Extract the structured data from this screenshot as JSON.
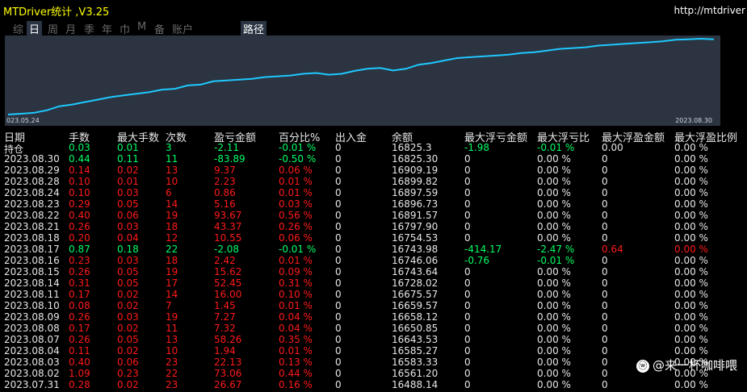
{
  "window": {
    "title": "MTDriver统计 ,V3.25",
    "url": "http://mtdriver"
  },
  "tabs": [
    {
      "label": "综"
    },
    {
      "label": "日"
    },
    {
      "label": "周"
    },
    {
      "label": "月"
    },
    {
      "label": "季"
    },
    {
      "label": "年"
    },
    {
      "label": "巾"
    },
    {
      "label": "M"
    },
    {
      "label": "备"
    },
    {
      "label": "账户"
    },
    {
      "label": "路径"
    }
  ],
  "chart": {
    "start_date": "023.05.24",
    "end_date": "2023.08.30",
    "line_color": "#1ec8ff",
    "background": "#2b3440"
  },
  "chart_data": {
    "type": "line",
    "x": [
      "023.05.24",
      "2023.08.30"
    ],
    "series": [
      {
        "values": [
          15000,
          15020,
          15040,
          15100,
          15200,
          15240,
          15300,
          15360,
          15420,
          15460,
          15500,
          15540,
          15600,
          15620,
          15700,
          15720,
          15800,
          15820,
          15840,
          15860,
          15900,
          15920,
          15940,
          15980,
          16000,
          15960,
          15980,
          16050,
          16100,
          16120,
          16060,
          16100,
          16200,
          16240,
          16300,
          16360,
          16380,
          16400,
          16420,
          16440,
          16480,
          16500,
          16540,
          16580,
          16600,
          16620,
          16660,
          16680,
          16700,
          16720,
          16740,
          16760,
          16800,
          16810,
          16825,
          16810
        ]
      }
    ]
  },
  "colors": {
    "positive": "#00ff66",
    "negative": "#ff1a1a",
    "neutral": "#e6e6e6",
    "title": "#ffff00"
  },
  "table": {
    "headers": [
      "日期",
      "手数",
      "最大手数",
      "次数",
      "盈亏金额",
      "百分比%",
      "出入金",
      "余额",
      "最大浮亏金额",
      "最大浮亏比",
      "最大浮盈金额",
      "最大浮盈比例"
    ],
    "rows": [
      {
        "date": "持仓",
        "lots": "0.03",
        "maxlots": "0.01",
        "count": "3",
        "pnl": "-2.11",
        "pct": "-0.01 %",
        "io": "0",
        "bal": "16825.3",
        "mfl": "-1.98",
        "mflp": "-0.01 %",
        "mfp": "0.00",
        "mfpp": "0.00 %",
        "color": "pos"
      },
      {
        "date": "2023.08.30",
        "lots": "0.44",
        "maxlots": "0.11",
        "count": "11",
        "pnl": "-83.89",
        "pct": "-0.50 %",
        "io": "0",
        "bal": "16825.30",
        "mfl": "0",
        "mflp": "0.00 %",
        "mfp": "0",
        "mfpp": "0.00 %",
        "color": "pos"
      },
      {
        "date": "2023.08.29",
        "lots": "0.14",
        "maxlots": "0.02",
        "count": "13",
        "pnl": "9.37",
        "pct": "0.06 %",
        "io": "0",
        "bal": "16909.19",
        "mfl": "0",
        "mflp": "0.00 %",
        "mfp": "0",
        "mfpp": "0.00 %",
        "color": "neg"
      },
      {
        "date": "2023.08.28",
        "lots": "0.10",
        "maxlots": "0.01",
        "count": "10",
        "pnl": "2.23",
        "pct": "0.01 %",
        "io": "0",
        "bal": "16899.82",
        "mfl": "0",
        "mflp": "0.00 %",
        "mfp": "0",
        "mfpp": "0.00 %",
        "color": "neg"
      },
      {
        "date": "2023.08.24",
        "lots": "0.10",
        "maxlots": "0.03",
        "count": "6",
        "pnl": "0.86",
        "pct": "0.01 %",
        "io": "0",
        "bal": "16897.59",
        "mfl": "0",
        "mflp": "0.00 %",
        "mfp": "0",
        "mfpp": "0.00 %",
        "color": "neg"
      },
      {
        "date": "2023.08.23",
        "lots": "0.29",
        "maxlots": "0.05",
        "count": "14",
        "pnl": "5.16",
        "pct": "0.03 %",
        "io": "0",
        "bal": "16896.73",
        "mfl": "0",
        "mflp": "0.00 %",
        "mfp": "0",
        "mfpp": "0.00 %",
        "color": "neg"
      },
      {
        "date": "2023.08.22",
        "lots": "0.40",
        "maxlots": "0.06",
        "count": "19",
        "pnl": "93.67",
        "pct": "0.56 %",
        "io": "0",
        "bal": "16891.57",
        "mfl": "0",
        "mflp": "0.00 %",
        "mfp": "0",
        "mfpp": "0.00 %",
        "color": "neg"
      },
      {
        "date": "2023.08.21",
        "lots": "0.26",
        "maxlots": "0.03",
        "count": "18",
        "pnl": "43.37",
        "pct": "0.26 %",
        "io": "0",
        "bal": "16797.90",
        "mfl": "0",
        "mflp": "0.00 %",
        "mfp": "0",
        "mfpp": "0.00 %",
        "color": "neg"
      },
      {
        "date": "2023.08.18",
        "lots": "0.20",
        "maxlots": "0.04",
        "count": "12",
        "pnl": "10.55",
        "pct": "0.06 %",
        "io": "0",
        "bal": "16754.53",
        "mfl": "0",
        "mflp": "0.00 %",
        "mfp": "0",
        "mfpp": "0.00 %",
        "color": "neg"
      },
      {
        "date": "2023.08.17",
        "lots": "0.87",
        "maxlots": "0.18",
        "count": "22",
        "pnl": "-2.08",
        "pct": "-0.01 %",
        "io": "0",
        "bal": "16743.98",
        "mfl": "-414.17",
        "mflp": "-2.47 %",
        "mfp": "0.64",
        "mfpp": "0.00 %",
        "color": "pos",
        "mfp_red": true
      },
      {
        "date": "2023.08.16",
        "lots": "0.23",
        "maxlots": "0.03",
        "count": "18",
        "pnl": "2.42",
        "pct": "0.01 %",
        "io": "0",
        "bal": "16746.06",
        "mfl": "-0.76",
        "mflp": "-0.01 %",
        "mfp": "0",
        "mfpp": "0.00 %",
        "color": "neg",
        "mfl_green": true
      },
      {
        "date": "2023.08.15",
        "lots": "0.26",
        "maxlots": "0.05",
        "count": "19",
        "pnl": "15.62",
        "pct": "0.09 %",
        "io": "0",
        "bal": "16743.64",
        "mfl": "0",
        "mflp": "0.00 %",
        "mfp": "0",
        "mfpp": "0.00 %",
        "color": "neg"
      },
      {
        "date": "2023.08.14",
        "lots": "0.31",
        "maxlots": "0.05",
        "count": "17",
        "pnl": "52.45",
        "pct": "0.31 %",
        "io": "0",
        "bal": "16728.02",
        "mfl": "0",
        "mflp": "0.00 %",
        "mfp": "0",
        "mfpp": "0.00 %",
        "color": "neg"
      },
      {
        "date": "2023.08.11",
        "lots": "0.17",
        "maxlots": "0.02",
        "count": "14",
        "pnl": "16.00",
        "pct": "0.10 %",
        "io": "0",
        "bal": "16675.57",
        "mfl": "0",
        "mflp": "0.00 %",
        "mfp": "0",
        "mfpp": "0.00 %",
        "color": "neg"
      },
      {
        "date": "2023.08.10",
        "lots": "0.08",
        "maxlots": "0.02",
        "count": "7",
        "pnl": "1.45",
        "pct": "0.01 %",
        "io": "0",
        "bal": "16659.57",
        "mfl": "0",
        "mflp": "0.00 %",
        "mfp": "0",
        "mfpp": "0.00 %",
        "color": "neg"
      },
      {
        "date": "2023.08.09",
        "lots": "0.26",
        "maxlots": "0.03",
        "count": "19",
        "pnl": "7.27",
        "pct": "0.04 %",
        "io": "0",
        "bal": "16658.12",
        "mfl": "0",
        "mflp": "0.00 %",
        "mfp": "0",
        "mfpp": "0.00 %",
        "color": "neg"
      },
      {
        "date": "2023.08.08",
        "lots": "0.17",
        "maxlots": "0.02",
        "count": "11",
        "pnl": "7.32",
        "pct": "0.04 %",
        "io": "0",
        "bal": "16650.85",
        "mfl": "0",
        "mflp": "0.00 %",
        "mfp": "0",
        "mfpp": "0.00 %",
        "color": "neg"
      },
      {
        "date": "2023.08.07",
        "lots": "0.26",
        "maxlots": "0.05",
        "count": "13",
        "pnl": "58.26",
        "pct": "0.35 %",
        "io": "0",
        "bal": "16643.53",
        "mfl": "0",
        "mflp": "0.00 %",
        "mfp": "0",
        "mfpp": "0.00 %",
        "color": "neg"
      },
      {
        "date": "2023.08.04",
        "lots": "0.11",
        "maxlots": "0.02",
        "count": "10",
        "pnl": "1.94",
        "pct": "0.01 %",
        "io": "0",
        "bal": "16585.27",
        "mfl": "0",
        "mflp": "0.00 %",
        "mfp": "0",
        "mfpp": "0.00 %",
        "color": "neg"
      },
      {
        "date": "2023.08.03",
        "lots": "0.40",
        "maxlots": "0.06",
        "count": "23",
        "pnl": "22.13",
        "pct": "0.13 %",
        "io": "0",
        "bal": "16583.33",
        "mfl": "0",
        "mflp": "0.00 %",
        "mfp": "0",
        "mfpp": "0.00 %",
        "color": "neg"
      },
      {
        "date": "2023.08.02",
        "lots": "1.09",
        "maxlots": "0.23",
        "count": "22",
        "pnl": "73.06",
        "pct": "0.44 %",
        "io": "0",
        "bal": "16561.20",
        "mfl": "0",
        "mflp": "0.00 %",
        "mfp": "0",
        "mfpp": "0.00 %",
        "color": "neg"
      },
      {
        "date": "2023.07.31",
        "lots": "0.28",
        "maxlots": "0.02",
        "count": "23",
        "pnl": "26.67",
        "pct": "0.16 %",
        "io": "0",
        "bal": "16488.14",
        "mfl": "0",
        "mflp": "0.00 %",
        "mfp": "0",
        "mfpp": "0.00 %",
        "color": "neg"
      }
    ]
  },
  "watermark": {
    "icon": "weibo-icon",
    "text": "@来一杯咖啡喂"
  }
}
